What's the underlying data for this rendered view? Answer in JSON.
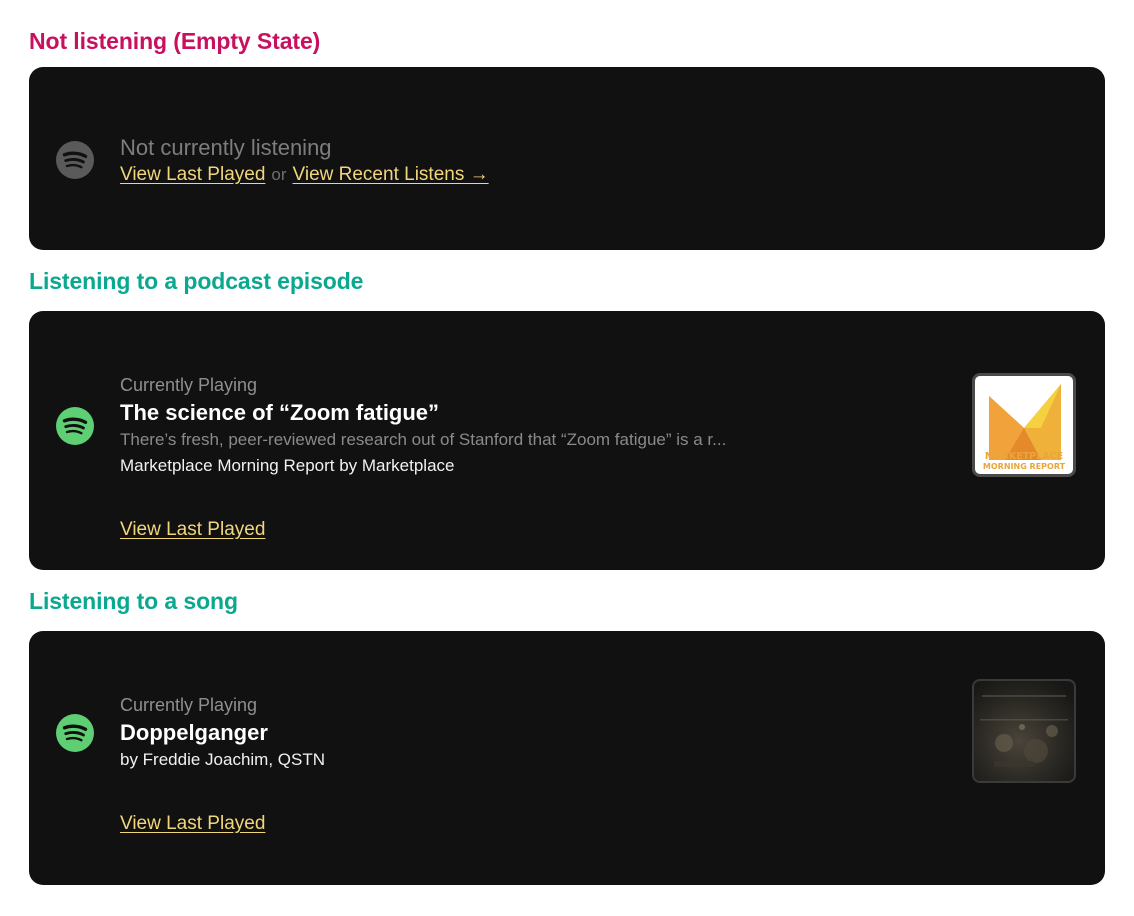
{
  "sections": {
    "empty": {
      "heading": "Not listening (Empty State)",
      "status": "Not currently listening",
      "link_last": "View Last Played",
      "or": "or",
      "link_recent": "View Recent Listens →"
    },
    "podcast": {
      "heading": "Listening to a podcast episode",
      "label": "Currently Playing",
      "title": "The science of “Zoom fatigue”",
      "description": "There’s fresh, peer-reviewed research out of Stanford that “Zoom fatigue” is a r...",
      "show": "Marketplace Morning Report by Marketplace",
      "link_last": "View Last Played",
      "art_line1": "MARKETPLACE",
      "art_line2": "MORNING REPORT"
    },
    "song": {
      "heading": "Listening to a song",
      "label": "Currently Playing",
      "title": "Doppelganger",
      "artists": "by Freddie Joachim, QSTN",
      "link_last": "View Last Played"
    }
  },
  "colors": {
    "heading_pink": "#c8105f",
    "heading_teal": "#0aa88f",
    "card_bg": "#111112",
    "link": "#f2d67a",
    "spotify_active": "#5fcf74",
    "spotify_inactive": "#5a5a5a"
  },
  "icons": {
    "spotify": "spotify-icon"
  }
}
